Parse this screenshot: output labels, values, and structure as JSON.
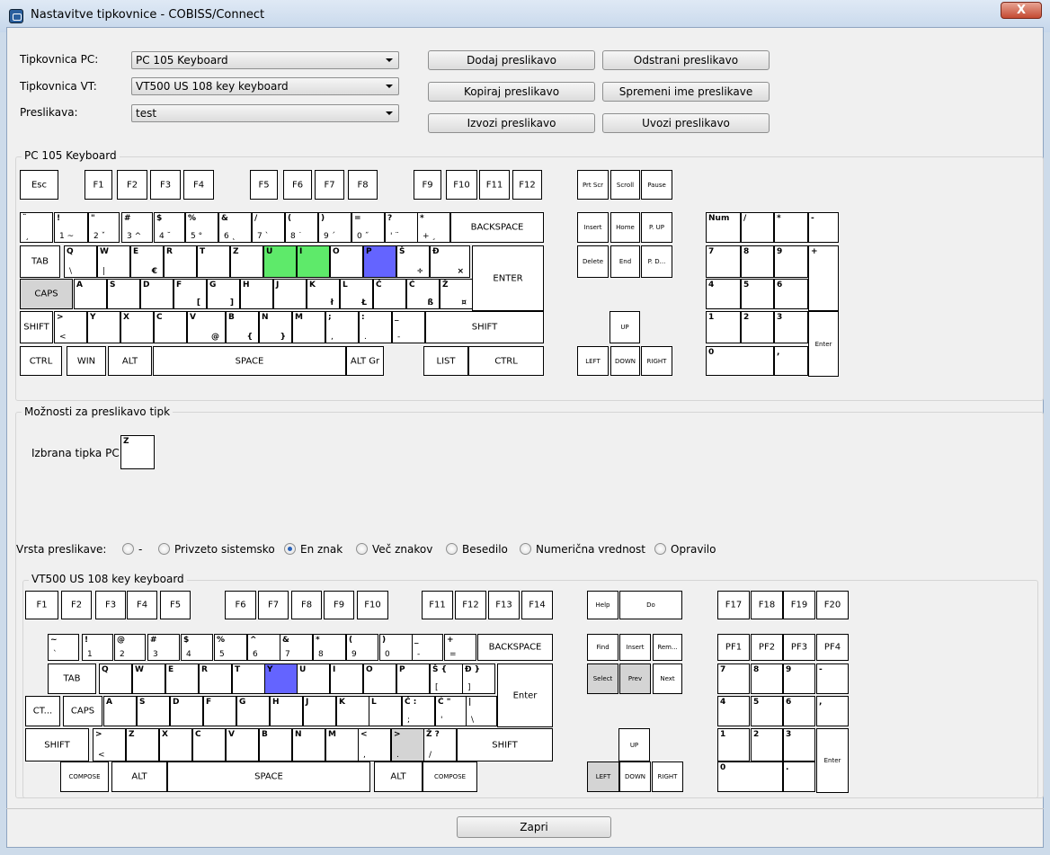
{
  "window": {
    "title": "Nastavitve tipkovnice - COBISS/Connect",
    "close_glyph": "X",
    "icon": "app-window-icon"
  },
  "form": {
    "pc_keyboard_label": "Tipkovnica PC:",
    "pc_keyboard_value": "PC 105 Keyboard",
    "vt_keyboard_label": "Tipkovnica VT:",
    "vt_keyboard_value": "VT500 US 108 key keyboard",
    "mapping_label": "Preslikava:",
    "mapping_value": "test"
  },
  "buttons": {
    "add": "Dodaj preslikavo",
    "remove": "Odstrani preslikavo",
    "copy": "Kopiraj preslikavo",
    "rename": "Spremeni ime preslikave",
    "export": "Izvozi preslikavo",
    "import": "Uvozi preslikavo",
    "close": "Zapri"
  },
  "pc_group_title": "PC 105 Keyboard",
  "options_group_title": "Možnosti za preslikavo tipk",
  "selected_key_label": "Izbrana tipka PC:",
  "selected_key_value": "Z",
  "mapping_type_label": "Vrsta preslikave:",
  "mapping_types": [
    "-",
    "Privzeto sistemsko",
    "En znak",
    "Več znakov",
    "Besedilo",
    "Numerična vrednost",
    "Opravilo"
  ],
  "mapping_type_selected": 2,
  "vt_group_title": "VT500 US 108 key keyboard",
  "colors": {
    "green": "#5eea6a",
    "blue": "#6464ff",
    "gray": "#d4d4d4",
    "alt_border": "#cc3a3a",
    "close": "#c44a32"
  },
  "pc_keys": [
    {
      "c": "Esc"
    },
    {
      "c": "F1"
    },
    {
      "c": "F2"
    },
    {
      "c": "F3"
    },
    {
      "c": "F4"
    },
    {
      "c": "F5"
    },
    {
      "c": "F6"
    },
    {
      "c": "F7"
    },
    {
      "c": "F8"
    },
    {
      "c": "F9"
    },
    {
      "c": "F10"
    },
    {
      "c": "F11"
    },
    {
      "c": "F12"
    },
    {
      "c": "Prt Scr",
      "s": 1
    },
    {
      "c": "Scroll",
      "s": 1
    },
    {
      "c": "Pause",
      "s": 1
    },
    {
      "tl": "¨",
      "bl": "¸"
    },
    {
      "tl": "!",
      "bl": "1 ~"
    },
    {
      "tl": "\"",
      "bl": "2 ˇ"
    },
    {
      "tl": "#",
      "bl": "3 ^"
    },
    {
      "tl": "$",
      "bl": "4 ˘"
    },
    {
      "tl": "%",
      "bl": "5 °"
    },
    {
      "tl": "&",
      "bl": "6 ˛"
    },
    {
      "tl": "/",
      "bl": "7 `"
    },
    {
      "tl": "(",
      "bl": "8 ˙"
    },
    {
      "tl": ")",
      "bl": "9 ´"
    },
    {
      "tl": "=",
      "bl": "0 ˝"
    },
    {
      "tl": "?",
      "bl": "' ¨"
    },
    {
      "tl": "*",
      "bl": "+ ¸"
    },
    {
      "c": "BACKSPACE"
    },
    {
      "c": "Insert",
      "s": 1
    },
    {
      "c": "Home",
      "s": 1
    },
    {
      "c": "P. UP",
      "s": 1
    },
    {
      "tl": "Num",
      "s": 1
    },
    {
      "tl": "/"
    },
    {
      "tl": "*"
    },
    {
      "tl": "-"
    },
    {
      "c": "TAB"
    },
    {
      "tl": "Q",
      "bl": "\\"
    },
    {
      "tl": "W",
      "bl": "|"
    },
    {
      "tl": "E",
      "br": "€"
    },
    {
      "tl": "R"
    },
    {
      "tl": "T"
    },
    {
      "tl": "Z"
    },
    {
      "tl": "U"
    },
    {
      "tl": "I"
    },
    {
      "tl": "O"
    },
    {
      "tl": "P"
    },
    {
      "tl": "Š",
      "br": "÷"
    },
    {
      "tl": "Đ",
      "br": "×"
    },
    {
      "c": "ENTER"
    },
    {
      "c": "Delete",
      "s": 1
    },
    {
      "c": "End",
      "s": 1
    },
    {
      "c": "P. D...",
      "s": 1
    },
    {
      "tl": "7"
    },
    {
      "tl": "8"
    },
    {
      "tl": "9"
    },
    {
      "tl": "+"
    },
    {
      "c": "CAPS"
    },
    {
      "tl": "A"
    },
    {
      "tl": "S"
    },
    {
      "tl": "D"
    },
    {
      "tl": "F",
      "br": "["
    },
    {
      "tl": "G",
      "br": "]"
    },
    {
      "tl": "H"
    },
    {
      "tl": "J"
    },
    {
      "tl": "K",
      "br": "ł"
    },
    {
      "tl": "L",
      "br": "Ł"
    },
    {
      "tl": "Č"
    },
    {
      "tl": "Ć",
      "br": "ß"
    },
    {
      "tl": "Ž",
      "br": "¤"
    },
    {
      "tl": "4"
    },
    {
      "tl": "5"
    },
    {
      "tl": "6"
    },
    {
      "c": "SHIFT"
    },
    {
      "tl": ">",
      "bl": "<"
    },
    {
      "tl": "Y"
    },
    {
      "tl": "X"
    },
    {
      "tl": "C"
    },
    {
      "tl": "V",
      "br": "@"
    },
    {
      "tl": "B",
      "br": "{"
    },
    {
      "tl": "N",
      "br": "}"
    },
    {
      "tl": "M"
    },
    {
      "tl": ";",
      "bl": ","
    },
    {
      "tl": ":",
      "bl": "."
    },
    {
      "tl": "_",
      "bl": "-"
    },
    {
      "c": "SHIFT"
    },
    {
      "c": "UP",
      "s": 1
    },
    {
      "tl": "1"
    },
    {
      "tl": "2"
    },
    {
      "tl": "3"
    },
    {
      "c": "Enter",
      "s": 1
    },
    {
      "c": "CTRL"
    },
    {
      "c": "WIN"
    },
    {
      "c": "ALT"
    },
    {
      "c": "SPACE"
    },
    {
      "c": "ALT Gr"
    },
    {
      "c": "LIST"
    },
    {
      "c": "CTRL"
    },
    {
      "c": "LEFT",
      "s": 1
    },
    {
      "c": "DOWN",
      "s": 1
    },
    {
      "c": "RIGHT",
      "s": 1
    },
    {
      "tl": "0"
    },
    {
      "tl": ","
    }
  ],
  "vt_keys": [
    {
      "c": "F1"
    },
    {
      "c": "F2"
    },
    {
      "c": "F3"
    },
    {
      "c": "F4"
    },
    {
      "c": "F5"
    },
    {
      "c": "F6"
    },
    {
      "c": "F7"
    },
    {
      "c": "F8"
    },
    {
      "c": "F9"
    },
    {
      "c": "F10"
    },
    {
      "c": "F11"
    },
    {
      "c": "F12"
    },
    {
      "c": "F13"
    },
    {
      "c": "F14"
    },
    {
      "c": "Help",
      "s": 1
    },
    {
      "c": "Do",
      "s": 1
    },
    {
      "c": "F17"
    },
    {
      "c": "F18"
    },
    {
      "c": "F19"
    },
    {
      "c": "F20"
    },
    {
      "tl": "~",
      "bl": "`"
    },
    {
      "tl": "!",
      "bl": "1"
    },
    {
      "tl": "@",
      "bl": "2"
    },
    {
      "tl": "#",
      "bl": "3"
    },
    {
      "tl": "$",
      "bl": "4"
    },
    {
      "tl": "%",
      "bl": "5"
    },
    {
      "tl": "^",
      "bl": "6"
    },
    {
      "tl": "&",
      "bl": "7"
    },
    {
      "tl": "*",
      "bl": "8"
    },
    {
      "tl": "(",
      "bl": "9"
    },
    {
      "tl": ")",
      "bl": "0"
    },
    {
      "tl": "_",
      "bl": "-"
    },
    {
      "tl": "+",
      "bl": "="
    },
    {
      "c": "BACKSPACE"
    },
    {
      "c": "Find",
      "s": 1
    },
    {
      "c": "Insert",
      "s": 1
    },
    {
      "c": "Rem...",
      "s": 1
    },
    {
      "c": "PF1"
    },
    {
      "c": "PF2"
    },
    {
      "c": "PF3"
    },
    {
      "c": "PF4"
    },
    {
      "c": "TAB"
    },
    {
      "tl": "Q"
    },
    {
      "tl": "W"
    },
    {
      "tl": "E"
    },
    {
      "tl": "R"
    },
    {
      "tl": "T"
    },
    {
      "tl": "Y"
    },
    {
      "tl": "U"
    },
    {
      "tl": "I"
    },
    {
      "tl": "O"
    },
    {
      "tl": "P"
    },
    {
      "tl": "Š {",
      "bl": "["
    },
    {
      "tl": "Đ }",
      "bl": "]"
    },
    {
      "c": "Enter"
    },
    {
      "c": "Select",
      "s": 1
    },
    {
      "c": "Prev",
      "s": 1
    },
    {
      "c": "Next",
      "s": 1
    },
    {
      "tl": "7"
    },
    {
      "tl": "8"
    },
    {
      "tl": "9"
    },
    {
      "tl": "-"
    },
    {
      "c": "CT..."
    },
    {
      "c": "CAPS"
    },
    {
      "tl": "A"
    },
    {
      "tl": "S"
    },
    {
      "tl": "D"
    },
    {
      "tl": "F"
    },
    {
      "tl": "G"
    },
    {
      "tl": "H"
    },
    {
      "tl": "J"
    },
    {
      "tl": "K"
    },
    {
      "tl": "L"
    },
    {
      "tl": "Č :",
      "bl": ";"
    },
    {
      "tl": "Ć \"",
      "bl": "'"
    },
    {
      "tl": "|",
      "bl": "\\"
    },
    {
      "tl": "4"
    },
    {
      "tl": "5"
    },
    {
      "tl": "6"
    },
    {
      "tl": ","
    },
    {
      "c": "SHIFT"
    },
    {
      "tl": ">",
      "bl": "<"
    },
    {
      "tl": "Z"
    },
    {
      "tl": "X"
    },
    {
      "tl": "C"
    },
    {
      "tl": "V"
    },
    {
      "tl": "B"
    },
    {
      "tl": "N"
    },
    {
      "tl": "M"
    },
    {
      "tl": "<",
      "bl": ","
    },
    {
      "tl": ">",
      "bl": "."
    },
    {
      "tl": "Ž ?",
      "bl": "/"
    },
    {
      "c": "SHIFT"
    },
    {
      "c": "UP",
      "s": 1
    },
    {
      "tl": "1"
    },
    {
      "tl": "2"
    },
    {
      "tl": "3"
    },
    {
      "c": "Enter",
      "s": 1
    },
    {
      "c": "COMPOSE",
      "s": 1
    },
    {
      "c": "ALT"
    },
    {
      "c": "SPACE"
    },
    {
      "c": "ALT"
    },
    {
      "c": "COMPOSE",
      "s": 1
    },
    {
      "c": "LEFT",
      "s": 1
    },
    {
      "c": "DOWN",
      "s": 1
    },
    {
      "c": "RIGHT",
      "s": 1
    },
    {
      "tl": "0"
    },
    {
      "tl": "."
    }
  ]
}
